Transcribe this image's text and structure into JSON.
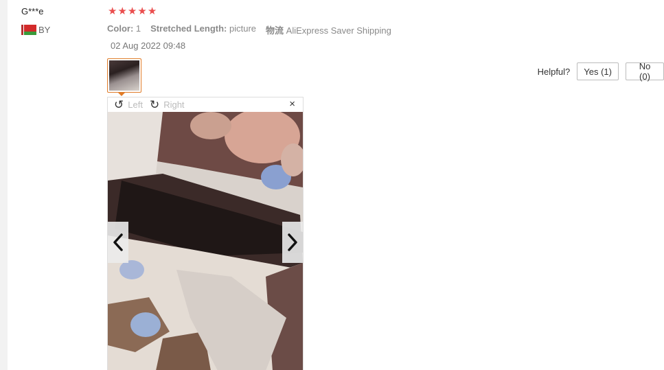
{
  "review": {
    "user_name": "G***e",
    "country_code": "BY",
    "rating": 5,
    "stars": [
      "★",
      "★",
      "★",
      "★",
      "★"
    ],
    "attributes": [
      {
        "key": "Color:",
        "value": "1"
      },
      {
        "key": "Stretched Length:",
        "value": "picture"
      },
      {
        "key": "物流",
        "value": "AliExpress Saver Shipping"
      }
    ],
    "date": "02 Aug 2022 09:48"
  },
  "helpful": {
    "label": "Helpful?",
    "yes_label": "Yes (1)",
    "no_label": "No (0)"
  },
  "viewer": {
    "rotate_left_label": "Left",
    "rotate_right_label": "Right",
    "close_icon": "×",
    "rotate_left_icon": "↺",
    "rotate_right_icon": "↻"
  },
  "colors": {
    "star": "#ea4e4e",
    "thumb_border": "#e07b27"
  }
}
